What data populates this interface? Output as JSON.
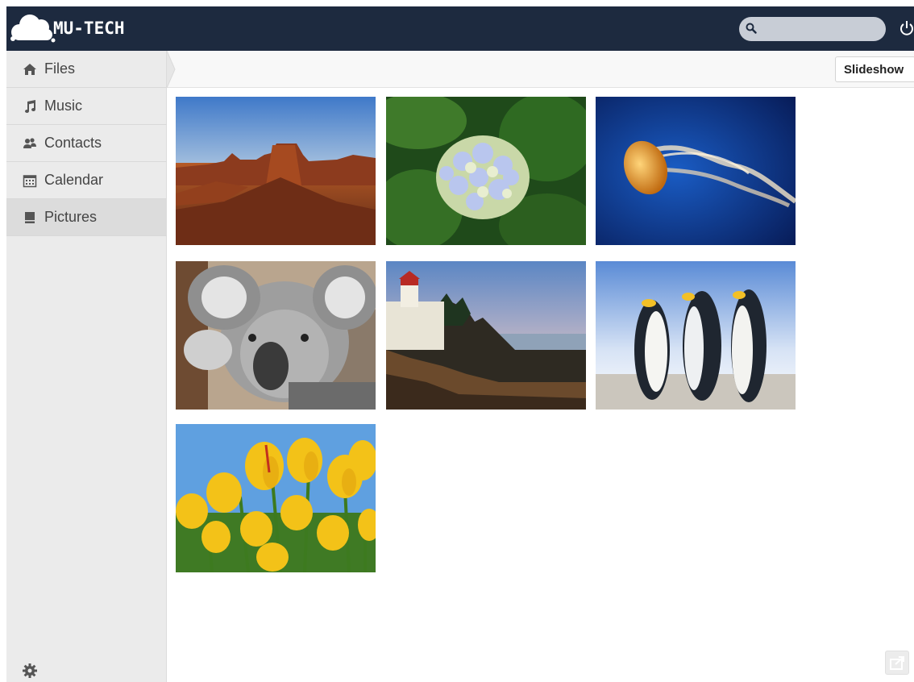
{
  "app": {
    "brand": "MU-TECH",
    "search_placeholder": ""
  },
  "sidebar": {
    "items": [
      {
        "label": "Files",
        "icon": "home-icon"
      },
      {
        "label": "Music",
        "icon": "music-icon"
      },
      {
        "label": "Contacts",
        "icon": "contacts-icon"
      },
      {
        "label": "Calendar",
        "icon": "calendar-icon"
      },
      {
        "label": "Pictures",
        "icon": "picture-icon",
        "active": true
      }
    ],
    "settings_icon": "gear-icon"
  },
  "controls": {
    "slideshow_label": "Slideshow"
  },
  "gallery": {
    "images": [
      {
        "subject": "desert"
      },
      {
        "subject": "hydrangea"
      },
      {
        "subject": "jellyfish"
      },
      {
        "subject": "koala"
      },
      {
        "subject": "lighthouse"
      },
      {
        "subject": "penguins"
      },
      {
        "subject": "tulips"
      }
    ]
  },
  "colors": {
    "header_bg": "#1d2a3f",
    "sidebar_bg": "#ebebeb",
    "active_item_bg": "#dcdcdc"
  }
}
